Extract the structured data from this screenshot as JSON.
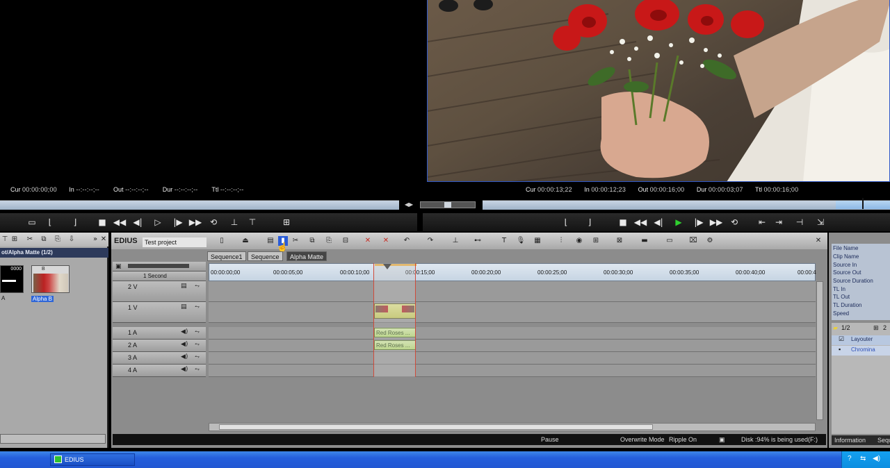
{
  "player": {
    "cur_label": "Cur",
    "cur": "00:00:00;00",
    "in_label": "In",
    "in": "--:--:--;--",
    "out_label": "Out",
    "out": "--:--:--;--",
    "dur_label": "Dur",
    "dur": "--:--:--;--",
    "ttl_label": "Ttl",
    "ttl": "--:--:--;--"
  },
  "recorder": {
    "cur_label": "Cur",
    "cur": "00:00:13;22",
    "in_label": "In",
    "in": "00:00:12;23",
    "out_label": "Out",
    "out": "00:00:16;00",
    "dur_label": "Dur",
    "dur": "00:00:03;07",
    "ttl_label": "Ttl",
    "ttl": "00:00:16;00"
  },
  "bin": {
    "title": "ot/Alpha Matte (1/2)",
    "clip_a_label": "A",
    "clip_b_label": "Alpha B",
    "clip_a_badge": "0000",
    "clip_b_badge": "B"
  },
  "timeline": {
    "logo": "EDIUS",
    "project_name": "Test project",
    "tabs": [
      "Sequence1",
      "Sequence",
      "Alpha Matte"
    ],
    "scale": "1 Second",
    "ruler": [
      "00:00:00;00",
      "00:00:05;00",
      "00:00:10;00",
      "00:00:15;00",
      "00:00:20;00",
      "00:00:25;00",
      "00:00:30;00",
      "00:00:35;00",
      "00:00:40;00",
      "00:00:4"
    ],
    "tracks": {
      "v2": "2 V",
      "v1": "1 V",
      "a1": "1 A",
      "a2": "2 A",
      "a3": "3 A",
      "a4": "4 A"
    },
    "audio_clip": "Red Roses ...",
    "status": {
      "mode": "Pause",
      "overwrite": "Overwrite Mode",
      "ripple": "Ripple On",
      "disk": "Disk :94% is being used(F:)"
    }
  },
  "info_panel": {
    "fields": [
      "File Name",
      "Clip Name",
      "Source In",
      "Source Out",
      "Source Duration",
      "TL In",
      "TL Out",
      "TL Duration",
      "Speed"
    ],
    "page": "1/2",
    "page_count": "2",
    "effects": [
      "Layouter",
      "Chromina"
    ],
    "tab_info": "Information",
    "tab_seq": "Sequ"
  },
  "taskbar": {
    "app": "EDIUS"
  },
  "colors": {
    "accent_blue": "#2e58c8",
    "timeline_bg": "#8c8c8c",
    "audio_clip": "#b8de70",
    "video_clip": "#c8cc58",
    "play_green": "#2fd02f"
  }
}
